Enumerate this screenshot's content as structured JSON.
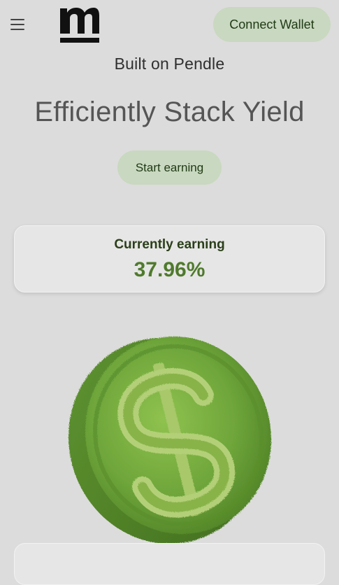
{
  "header": {
    "menu_icon": "hamburger-menu-icon",
    "logo_icon": "m-logo",
    "connect_wallet_label": "Connect Wallet"
  },
  "hero": {
    "subtitle": "Built on Pendle",
    "title": "Efficiently Stack Yield",
    "cta_label": "Start earning"
  },
  "earning": {
    "label": "Currently earning",
    "value": "37.96%"
  },
  "illustration": {
    "icon": "grass-dollar-coin"
  },
  "colors": {
    "background": "#dcdcdc",
    "button_bg": "#c9d8c0",
    "button_text": "#1f3a14",
    "accent_green": "#4f7a2c",
    "title_gray": "#555555"
  }
}
